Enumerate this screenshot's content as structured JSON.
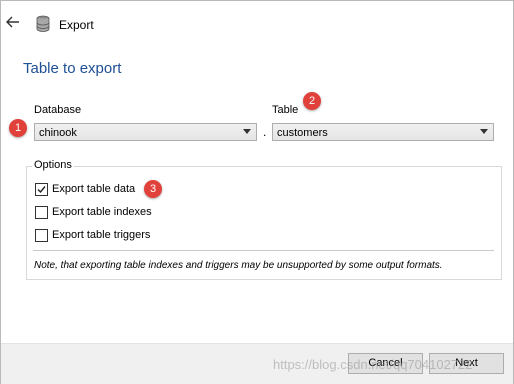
{
  "window": {
    "title": "Export",
    "icon": "database-icon"
  },
  "page_title": "Table to export",
  "database": {
    "label": "Database",
    "value": "chinook"
  },
  "separator": ".",
  "table": {
    "label": "Table",
    "value": "customers"
  },
  "options": {
    "legend": "Options",
    "items": [
      {
        "label": "Export table data",
        "checked": true
      },
      {
        "label": "Export table indexes",
        "checked": false
      },
      {
        "label": "Export table triggers",
        "checked": false
      }
    ],
    "note": "Note, that exporting table indexes and triggers may be unsupported by some output formats."
  },
  "markers": [
    "1",
    "2",
    "3"
  ],
  "buttons": {
    "cancel": "Cancel",
    "next": "Next"
  },
  "watermark": "https://blog.csdn.net/qq704102722",
  "colors": {
    "title": "#1f4f96",
    "marker": "#e0413a",
    "footer": "#f0f0f0"
  }
}
